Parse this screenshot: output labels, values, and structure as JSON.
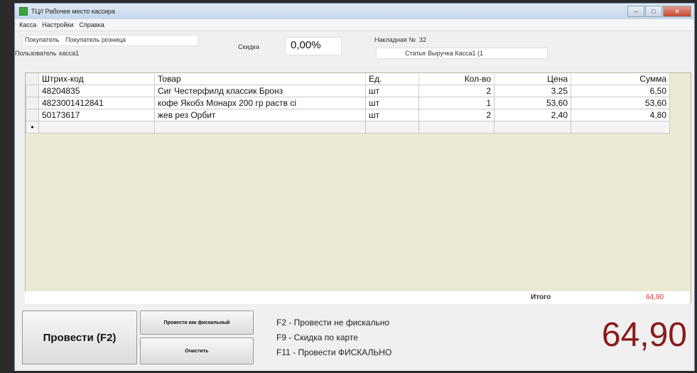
{
  "window": {
    "title": "ТЦ// Рабочее место кассира"
  },
  "menu": [
    "Касса",
    "Настройки",
    "Справка"
  ],
  "info": {
    "buyer_label": "Покупатель",
    "buyer_value": "Покупатель розница",
    "user_label": "Пользователь",
    "user_value": "кассa1",
    "discount_label": "Скидка",
    "discount_value": "0,00%",
    "invoice_label": "Накладная №",
    "invoice_value": "32",
    "article_label": "Статья",
    "article_value": "Выручка Касса1 (1"
  },
  "table": {
    "headers": [
      "Штрих-код",
      "Товар",
      "Ед.",
      "Кол-во",
      "Цена",
      "Сумма"
    ],
    "rows": [
      [
        "48204835",
        "Сиг Честерфилд классик Бронз",
        "шт",
        "2",
        "3,25",
        "6,50"
      ],
      [
        "4823001412841",
        "кофе Якобз Монарх 200 гр раств сі",
        "шт",
        "1",
        "53,60",
        "53,60"
      ],
      [
        "50173617",
        "жев рез Орбит",
        "шт",
        "2",
        "2,40",
        "4,80"
      ]
    ],
    "new_row_marker": "•"
  },
  "total": {
    "label": "Итого",
    "value": "64,90"
  },
  "buttons": {
    "post": "Провести (F2)",
    "post_fiscal": "Провести как фискальный",
    "clear": "Очистить"
  },
  "hotkeys": [
    "F2 - Провести не фискально",
    "F9 - Скидка по карте",
    "F11 - Провести ФИСКАЛЬНО"
  ],
  "big_total": "64,90",
  "colors": {
    "total_red": "#d03030",
    "big_total": "#8b1a1a"
  }
}
